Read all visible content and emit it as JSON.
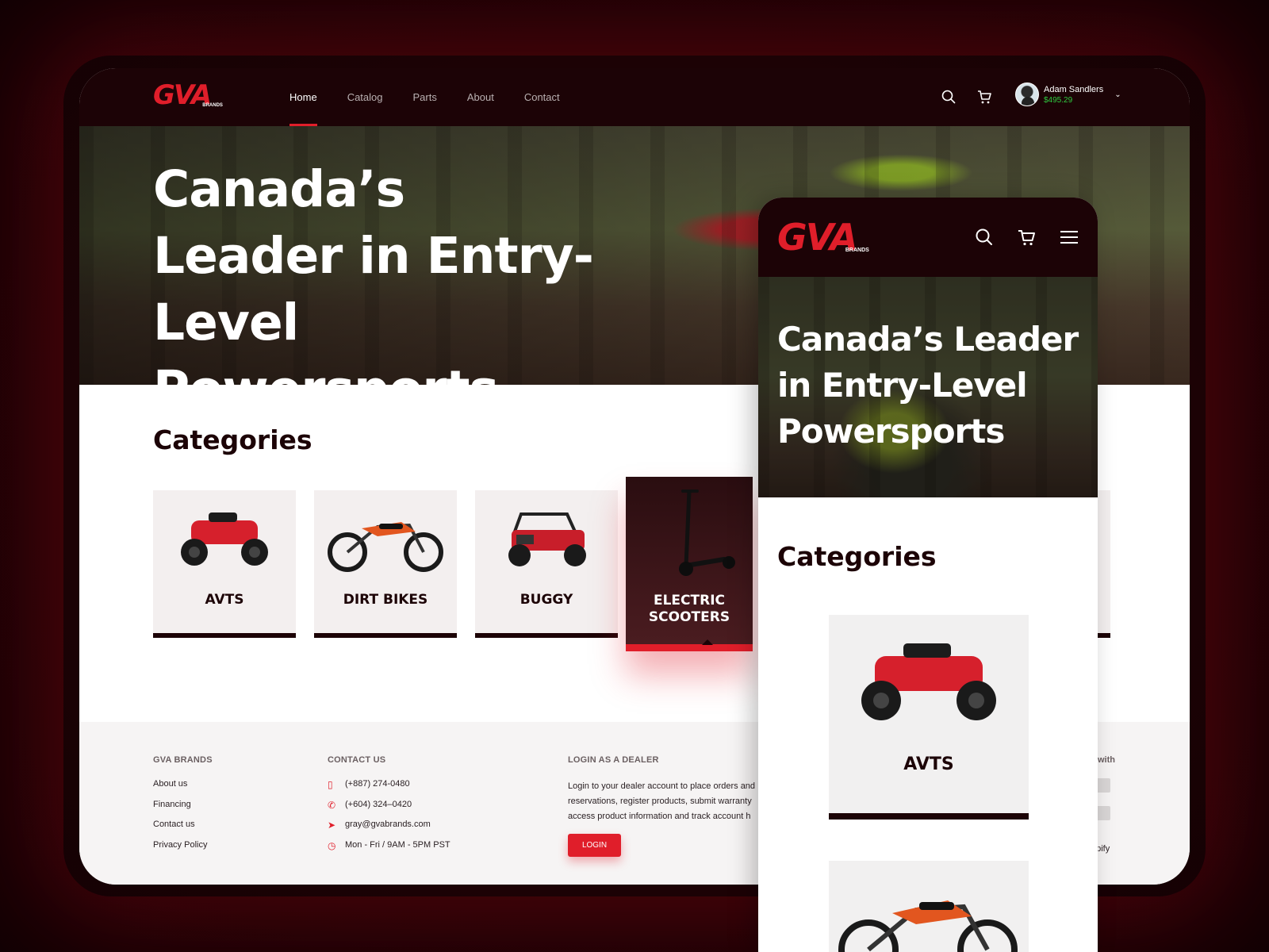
{
  "brand": {
    "mark": "GVA",
    "sub": "BRANDS"
  },
  "nav": {
    "links": [
      "Home",
      "Catalog",
      "Parts",
      "About",
      "Contact"
    ],
    "active": "Home"
  },
  "user": {
    "name": "Adam Sandlers",
    "balance": "$495.29"
  },
  "hero": {
    "title": "Canada’s Leader in Entry-Level Powersports"
  },
  "categories": {
    "title": "Categories",
    "items": [
      "AVTS",
      "DIRT BIKES",
      "BUGGY",
      "ELECTRIC SCOOTERS"
    ],
    "selected": "ELECTRIC SCOOTERS"
  },
  "footer": {
    "brand_col": {
      "heading": "GVA BRANDS",
      "links": [
        "About us",
        "Financing",
        "Contact us",
        "Privacy Policy"
      ]
    },
    "contact_col": {
      "heading": "CONTACT US",
      "items": [
        {
          "icon": "phone-mobile-icon",
          "text": "(+887) 274-0480"
        },
        {
          "icon": "phone-icon",
          "text": "(+604) 324–0420"
        },
        {
          "icon": "send-icon",
          "text": "gray@gvabrands.com"
        },
        {
          "icon": "clock-icon",
          "text": "Mon - Fri / 9AM - 5PM PST"
        }
      ]
    },
    "dealer_col": {
      "heading": "LOGIN AS A DEALER",
      "text": "Login to your dealer account to place orders and reservations, register products, submit warranty access product information and track account h",
      "button": "LOGIN"
    },
    "partial_col": {
      "heading_fragment": "with",
      "fragment": "opify"
    }
  },
  "colors": {
    "accent": "#e01e2a",
    "dark": "#1c0306",
    "balance": "#2ecc40"
  },
  "mobile": {
    "hero_title": "Canada’s Leader in Entry-Level Powersports",
    "categories_title": "Categories",
    "first_card": "AVTS"
  }
}
